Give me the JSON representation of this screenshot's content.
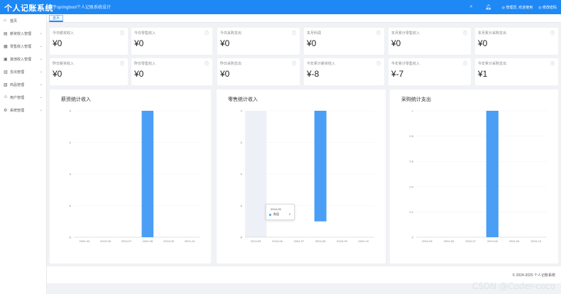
{
  "app": {
    "title": "个人记账系统",
    "subtitle": "基于springboot个人记账系统设计",
    "user_label": "管理员, 欢迎使用",
    "password_label": "修改密码",
    "search_icon": "search-icon",
    "bell_icon": "bell-icon"
  },
  "sidebar": {
    "items": [
      {
        "label": "首页",
        "icon": "home-icon",
        "has_arrow": false
      },
      {
        "label": "薪资收入管理",
        "icon": "salary-icon",
        "has_arrow": true
      },
      {
        "label": "零售收入管理",
        "icon": "retail-icon",
        "has_arrow": true
      },
      {
        "label": "其他收入管理",
        "icon": "other-income-icon",
        "has_arrow": true
      },
      {
        "label": "支出管理",
        "icon": "expense-icon",
        "has_arrow": true
      },
      {
        "label": "商品管理",
        "icon": "goods-icon",
        "has_arrow": true
      },
      {
        "label": "用户管理",
        "icon": "user-icon",
        "has_arrow": true
      },
      {
        "label": "系统管理",
        "icon": "system-icon",
        "has_arrow": true
      }
    ]
  },
  "tabs": [
    {
      "label": "首页"
    }
  ],
  "stats": [
    {
      "label": "今日薪资收入",
      "value": "¥0"
    },
    {
      "label": "今日零售收入",
      "value": "¥0"
    },
    {
      "label": "今日采购支出",
      "value": "¥0"
    },
    {
      "label": "本月利润",
      "value": "¥0"
    },
    {
      "label": "本月累计零售收入",
      "value": "¥0"
    },
    {
      "label": "本月累计采购支出",
      "value": "¥0"
    },
    {
      "label": "昨日薪资收入",
      "value": "¥0"
    },
    {
      "label": "昨日零售收入",
      "value": "¥0"
    },
    {
      "label": "昨日采购支出",
      "value": "¥0"
    },
    {
      "label": "今年累计薪资收入",
      "value": "¥-8"
    },
    {
      "label": "今年累计零售收入",
      "value": "¥-7"
    },
    {
      "label": "今年累计采购支出",
      "value": "¥1"
    }
  ],
  "charts": [
    {
      "title": "薪资统计收入"
    },
    {
      "title": "零售统计收入"
    },
    {
      "title": "采购统计支出"
    }
  ],
  "chart_data": [
    {
      "type": "bar",
      "title": "薪资统计收入",
      "categories": [
        "2024-03",
        "2024-06",
        "2024-07",
        "2024-08",
        "2024-09",
        "2024-10"
      ],
      "values": [
        0,
        0,
        0,
        -8,
        0,
        0
      ],
      "y_ticks": [
        0,
        -2,
        -4,
        -6,
        -8
      ],
      "ylim": [
        -8,
        0
      ],
      "color": "#4a9ef5"
    },
    {
      "type": "bar",
      "title": "零售统计收入",
      "categories": [
        "2024-05",
        "2024-06",
        "2024-07",
        "2024-08",
        "2024-09",
        "2024-10"
      ],
      "values": [
        0,
        0,
        0,
        -7,
        0,
        0
      ],
      "y_ticks": [
        0,
        -2,
        -4,
        -6,
        -8
      ],
      "ylim": [
        -8,
        0
      ],
      "color": "#4a9ef5",
      "highlight_index": 0,
      "tooltip": {
        "title": "2024-05",
        "series": "数值",
        "value": "0"
      }
    },
    {
      "type": "bar",
      "title": "采购统计支出",
      "categories": [
        "2024-05",
        "2024-06",
        "2024-07",
        "2024-08",
        "2024-09",
        "2024-10"
      ],
      "values": [
        0,
        0,
        0,
        1,
        0,
        0
      ],
      "y_ticks": [
        1,
        0.8,
        0.6,
        0.4,
        0.2,
        0
      ],
      "ylim": [
        0,
        1
      ],
      "color": "#4a9ef5"
    }
  ],
  "footer": {
    "copyright": "© 2024-2025 个人记账系统"
  },
  "watermark": "CSDN @Coder-coco",
  "colors": {
    "primary": "#1e88f5",
    "bar": "#4a9ef5",
    "background": "#f0f2f5"
  }
}
